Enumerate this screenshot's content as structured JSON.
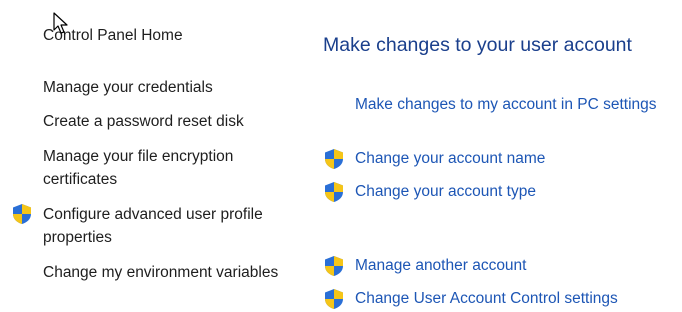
{
  "sidebar": {
    "home_label": "Control Panel Home",
    "items": [
      {
        "label": "Manage your credentials",
        "shield": false
      },
      {
        "label": "Create a password reset disk",
        "shield": false
      },
      {
        "label": "Manage your file encryption certificates",
        "shield": false
      },
      {
        "label": "Configure advanced user profile properties",
        "shield": true
      },
      {
        "label": "Change my environment variables",
        "shield": false
      }
    ]
  },
  "main": {
    "title": "Make changes to your user account",
    "links": [
      {
        "label": "Make changes to my account in PC settings",
        "shield": false
      },
      {
        "label": "Change your account name",
        "shield": true
      },
      {
        "label": "Change your account type",
        "shield": true
      },
      {
        "label": "Manage another account",
        "shield": true
      },
      {
        "label": "Change User Account Control settings",
        "shield": true
      }
    ]
  },
  "colors": {
    "title": "#1a3f8c",
    "link": "#1d56b5",
    "sidebar_text": "#1e1e1e",
    "shield_blue": "#2a6fd6",
    "shield_yellow": "#f5c518"
  },
  "icons": {
    "shield": "uac-shield-icon",
    "cursor": "mouse-pointer-icon"
  }
}
